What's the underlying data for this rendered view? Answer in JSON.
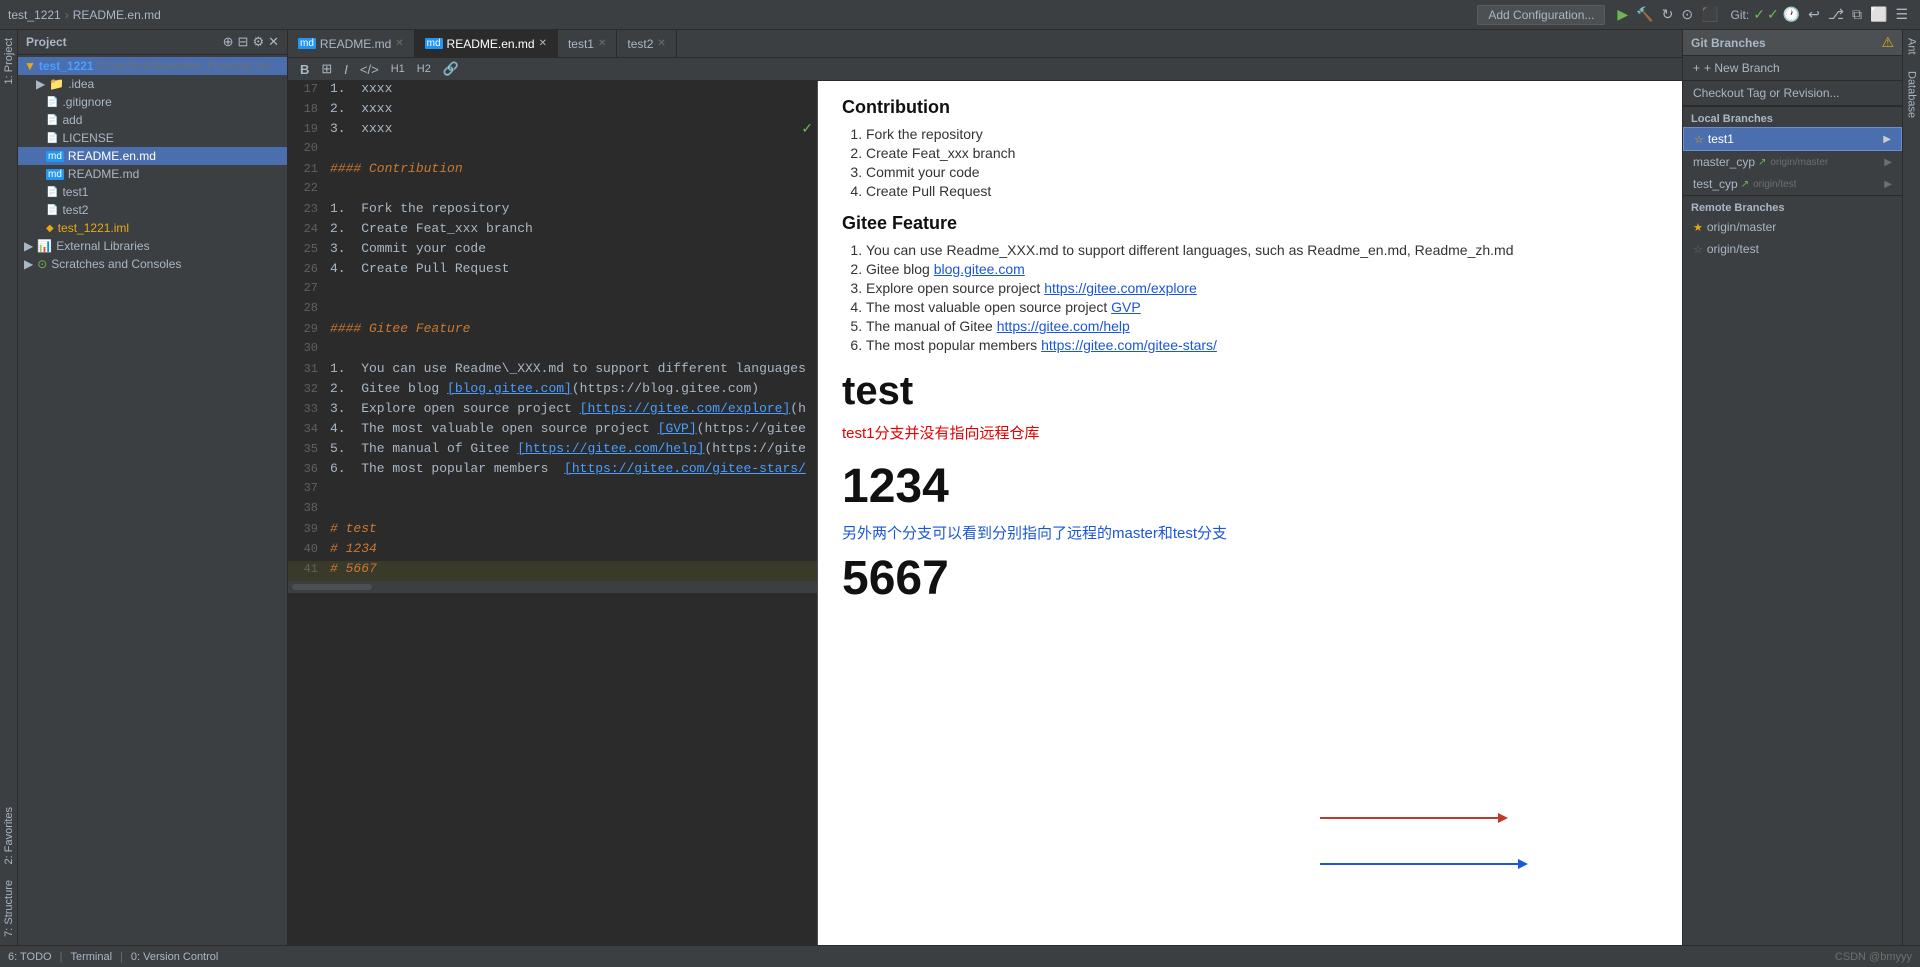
{
  "topbar": {
    "breadcrumb": [
      "test_1221",
      "README.en.md"
    ],
    "add_config_label": "Add Configuration...",
    "git_label": "Git:"
  },
  "tabs": [
    {
      "label": "README.md",
      "active": false,
      "type": "md"
    },
    {
      "label": "README.en.md",
      "active": true,
      "type": "md"
    },
    {
      "label": "test1",
      "active": false,
      "type": "file"
    },
    {
      "label": "test2",
      "active": false,
      "type": "file"
    }
  ],
  "project": {
    "title": "Project",
    "root": {
      "name": "test_1221",
      "path": "D:/cyp/WorkSpace/idea_Project/git_test/test_1",
      "children": [
        {
          "name": ".idea",
          "type": "folder"
        },
        {
          "name": ".gitignore",
          "type": "file"
        },
        {
          "name": "add",
          "type": "file"
        },
        {
          "name": "LICENSE",
          "type": "file"
        },
        {
          "name": "README.en.md",
          "type": "md",
          "selected": true
        },
        {
          "name": "README.md",
          "type": "md"
        },
        {
          "name": "test1",
          "type": "file"
        },
        {
          "name": "test2",
          "type": "file"
        },
        {
          "name": "test_1221.iml",
          "type": "iml"
        }
      ]
    },
    "external_libraries": "External Libraries",
    "scratches": "Scratches and Consoles"
  },
  "code_lines": [
    {
      "num": 17,
      "content": "1.  xxxx",
      "type": "list"
    },
    {
      "num": 18,
      "content": "2.  xxxx",
      "type": "list"
    },
    {
      "num": 19,
      "content": "3.  xxxx",
      "type": "list"
    },
    {
      "num": 20,
      "content": "",
      "type": "empty"
    },
    {
      "num": 21,
      "content": "#### Contribution",
      "type": "heading"
    },
    {
      "num": 22,
      "content": "",
      "type": "empty"
    },
    {
      "num": 23,
      "content": "1.  Fork the repository",
      "type": "list"
    },
    {
      "num": 24,
      "content": "2.  Create Feat_xxx branch",
      "type": "list"
    },
    {
      "num": 25,
      "content": "3.  Commit your code",
      "type": "list"
    },
    {
      "num": 26,
      "content": "4.  Create Pull Request",
      "type": "list"
    },
    {
      "num": 27,
      "content": "",
      "type": "empty"
    },
    {
      "num": 28,
      "content": "",
      "type": "empty"
    },
    {
      "num": 29,
      "content": "#### Gitee Feature",
      "type": "heading"
    },
    {
      "num": 30,
      "content": "",
      "type": "empty"
    },
    {
      "num": 31,
      "content": "1.  You can use Readme\\_XXX.md to support different languages",
      "type": "list"
    },
    {
      "num": 32,
      "content": "2.  Gitee blog [blog.gitee.com](https://blog.gitee.com)",
      "type": "list-link"
    },
    {
      "num": 33,
      "content": "3.  Explore open source project [https://gitee.com/explore](h",
      "type": "list-link"
    },
    {
      "num": 34,
      "content": "4.  The most valuable open source project [GVP](https://gitee",
      "type": "list-link"
    },
    {
      "num": 35,
      "content": "5.  The manual of Gitee [https://gitee.com/help](https://gite",
      "type": "list-link"
    },
    {
      "num": 36,
      "content": "6.  The most popular members  [https://gitee.com/gitee-stars/",
      "type": "list-link"
    },
    {
      "num": 37,
      "content": "",
      "type": "empty"
    },
    {
      "num": 38,
      "content": "",
      "type": "empty"
    },
    {
      "num": 39,
      "content": "# test",
      "type": "heading"
    },
    {
      "num": 40,
      "content": "# 1234",
      "type": "heading"
    },
    {
      "num": 41,
      "content": "# 5667",
      "type": "heading-highlight"
    }
  ],
  "preview": {
    "contribution_title": "Contribution",
    "contribution_items": [
      "Fork the repository",
      "Create Feat_xxx branch",
      "Commit your code",
      "Create Pull Request"
    ],
    "gitee_feature_title": "Gitee Feature",
    "gitee_items": [
      {
        "text": "You can use Readme_XXX.md to support different languages, such as Readme_en.md, Readme_zh.md",
        "link": null
      },
      {
        "text": "Gitee blog ",
        "link": "blog.gitee.com"
      },
      {
        "text": "Explore open source project ",
        "link": "https://gitee.com/explore"
      },
      {
        "text": "The most valuable open source project ",
        "link": "GVP"
      },
      {
        "text": "The manual of Gitee ",
        "link": "https://gitee.com/help"
      },
      {
        "text": "The most popular members ",
        "link": "https://gitee.com/gitee-stars/"
      }
    ],
    "test_title": "test",
    "num_1234": "1234",
    "num_5667": "5667",
    "annotation_red": "test1分支并没有指向远程仓库",
    "annotation_blue": "另外两个分支可以看到分别指向了远程的master和test分支"
  },
  "git_branches": {
    "title": "Git Branches",
    "new_branch": "+ New Branch",
    "checkout_tag": "Checkout Tag or Revision...",
    "local_branches_label": "Local Branches",
    "local_branches": [
      {
        "name": "test1",
        "selected": true,
        "star": false,
        "origin": null
      },
      {
        "name": "master_cyp",
        "selected": false,
        "star": false,
        "origin": "origin/master"
      },
      {
        "name": "test_cyp",
        "selected": false,
        "star": false,
        "origin": "origin/test"
      }
    ],
    "remote_branches_label": "Remote Branches",
    "remote_branches": [
      {
        "name": "origin/master",
        "star": true
      },
      {
        "name": "origin/test",
        "star": false
      }
    ]
  },
  "bottom_bar": {
    "todo": "6: TODO",
    "terminal": "Terminal",
    "version_control": "0: Version Control",
    "csdn": "CSDN @bmyyy"
  },
  "sidebar_tabs": {
    "left": [
      "1: Project",
      "2: Favorites",
      "7: Structure"
    ],
    "right": [
      "Ant",
      "Database"
    ]
  }
}
